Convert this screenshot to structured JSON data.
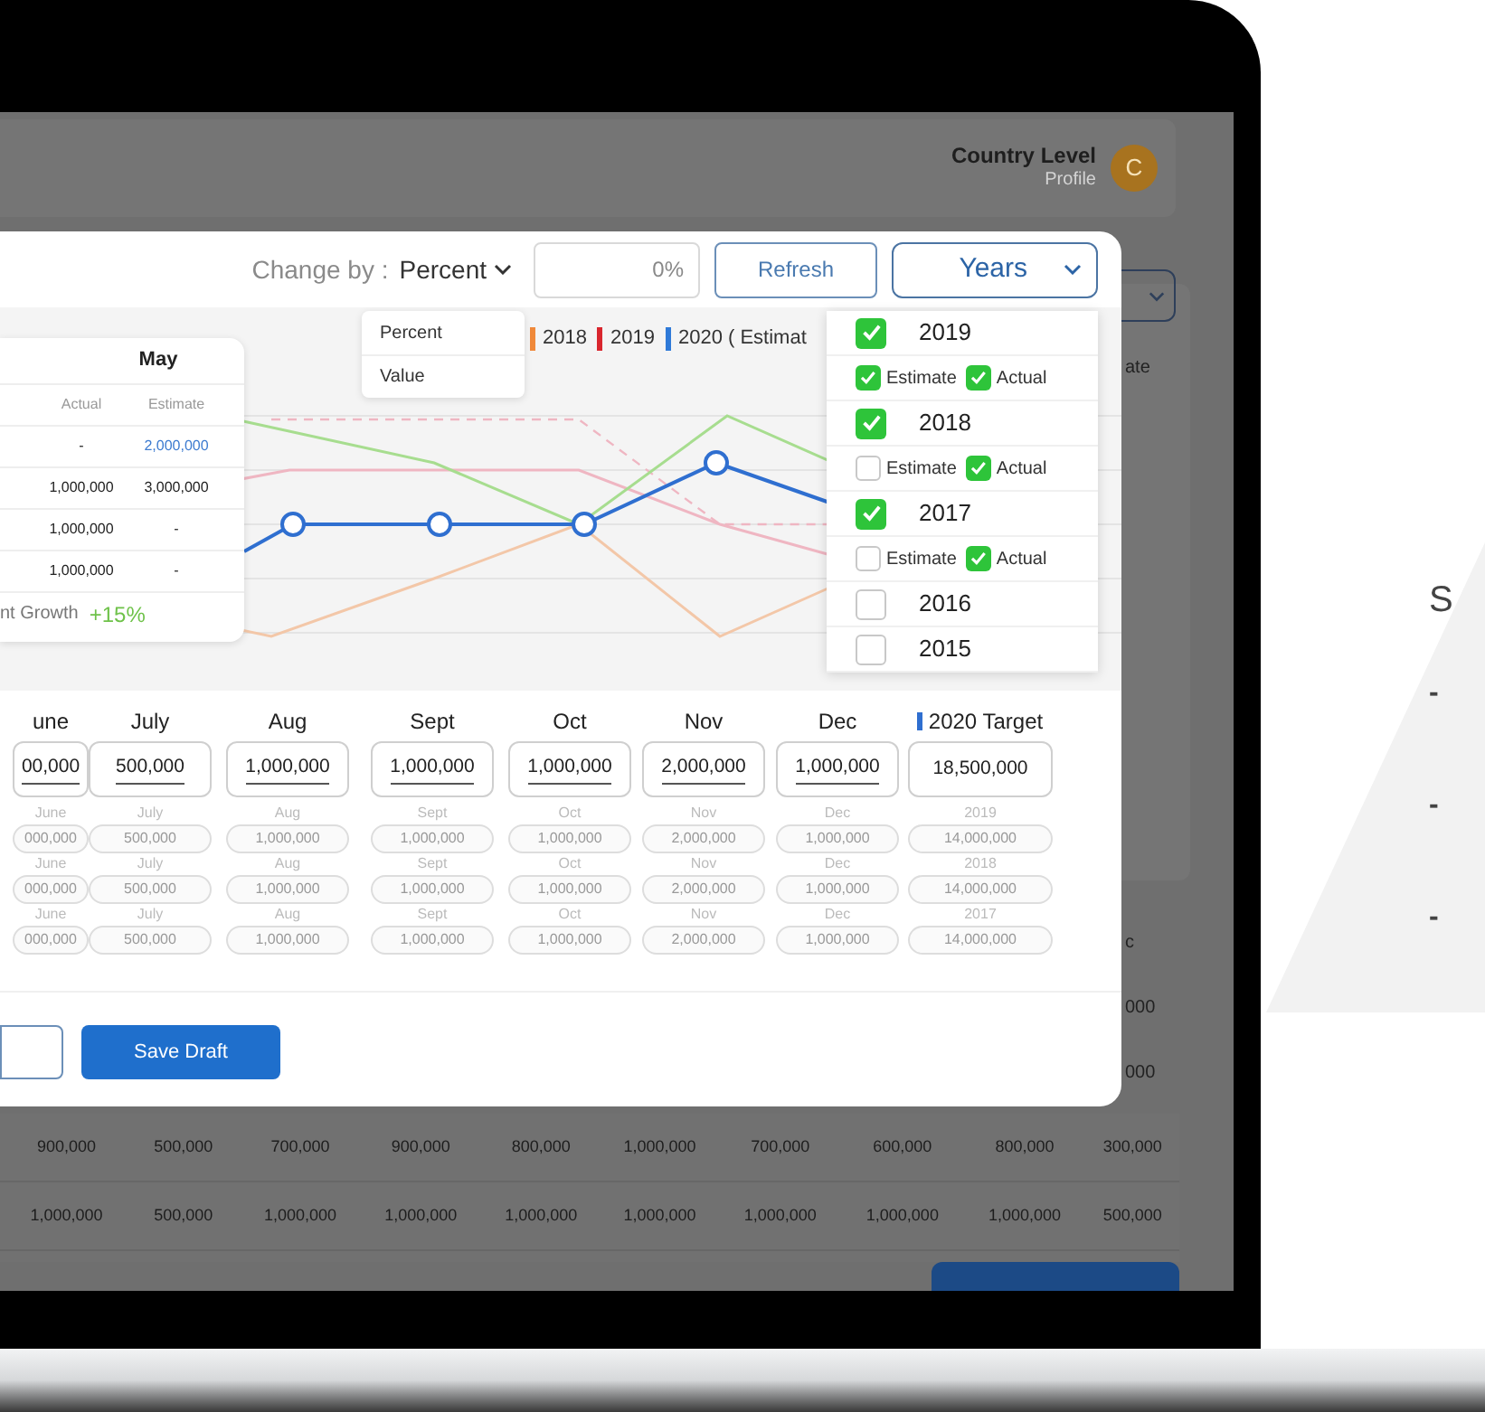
{
  "header": {
    "title": "Country Level",
    "subtitle": "Profile",
    "avatar": "C"
  },
  "toolbar": {
    "change_by_label": "Change by :",
    "mode": "Percent",
    "amount": "0%",
    "refresh": "Refresh",
    "years": "Years"
  },
  "mode_menu": [
    {
      "label": "Percent"
    },
    {
      "label": "Value"
    }
  ],
  "legend": [
    {
      "label": "2018",
      "color": "#f0893a"
    },
    {
      "label": "2019",
      "color": "#d9262e"
    },
    {
      "label": "2020 ( Estimat",
      "color": "#2f7ad8"
    }
  ],
  "tooltip": {
    "title": "May",
    "columns": [
      "Actual",
      "Estimate"
    ],
    "rows": [
      {
        "actual": "-",
        "estimate": "2,000,000",
        "highlighted": true
      },
      {
        "actual": "1,000,000",
        "estimate": "3,000,000",
        "highlighted": false
      },
      {
        "actual": "1,000,000",
        "estimate": "-",
        "highlighted": false
      },
      {
        "actual": "1,000,000",
        "estimate": "-",
        "highlighted": false
      }
    ],
    "growth_label": "nt Growth",
    "growth": "+15%"
  },
  "years_panel": [
    {
      "year": "2019",
      "checked": true,
      "options": [
        {
          "label": "Estimate",
          "checked": true
        },
        {
          "label": "Actual",
          "checked": true
        }
      ]
    },
    {
      "year": "2018",
      "checked": true,
      "options": [
        {
          "label": "Estimate",
          "checked": false
        },
        {
          "label": "Actual",
          "checked": true
        }
      ]
    },
    {
      "year": "2017",
      "checked": true,
      "options": [
        {
          "label": "Estimate",
          "checked": false
        },
        {
          "label": "Actual",
          "checked": true
        }
      ]
    },
    {
      "year": "2016",
      "checked": false
    },
    {
      "year": "2015",
      "checked": false
    }
  ],
  "months": [
    {
      "label": "une",
      "value": "00,000",
      "history": [
        {
          "label": "June",
          "value": "000,000"
        },
        {
          "label": "June",
          "value": "000,000"
        },
        {
          "label": "June",
          "value": "000,000"
        }
      ]
    },
    {
      "label": "July",
      "value": "500,000",
      "history": [
        {
          "label": "July",
          "value": "500,000"
        },
        {
          "label": "July",
          "value": "500,000"
        },
        {
          "label": "July",
          "value": "500,000"
        }
      ]
    },
    {
      "label": "Aug",
      "value": "1,000,000",
      "history": [
        {
          "label": "Aug",
          "value": "1,000,000"
        },
        {
          "label": "Aug",
          "value": "1,000,000"
        },
        {
          "label": "Aug",
          "value": "1,000,000"
        }
      ]
    },
    {
      "label": "Sept",
      "value": "1,000,000",
      "history": [
        {
          "label": "Sept",
          "value": "1,000,000"
        },
        {
          "label": "Sept",
          "value": "1,000,000"
        },
        {
          "label": "Sept",
          "value": "1,000,000"
        }
      ]
    },
    {
      "label": "Oct",
      "value": "1,000,000",
      "history": [
        {
          "label": "Oct",
          "value": "1,000,000"
        },
        {
          "label": "Oct",
          "value": "1,000,000"
        },
        {
          "label": "Oct",
          "value": "1,000,000"
        }
      ]
    },
    {
      "label": "Nov",
      "value": "2,000,000",
      "history": [
        {
          "label": "Nov",
          "value": "2,000,000"
        },
        {
          "label": "Nov",
          "value": "2,000,000"
        },
        {
          "label": "Nov",
          "value": "2,000,000"
        }
      ]
    },
    {
      "label": "Dec",
      "value": "1,000,000",
      "history": [
        {
          "label": "Dec",
          "value": "1,000,000"
        },
        {
          "label": "Dec",
          "value": "1,000,000"
        },
        {
          "label": "Dec",
          "value": "1,000,000"
        }
      ]
    },
    {
      "label": "2020 Target",
      "value": "18,500,000",
      "kind": "target",
      "history": [
        {
          "label": "2019",
          "value": "14,000,000"
        },
        {
          "label": "2018",
          "value": "14,000,000"
        },
        {
          "label": "2017",
          "value": "14,000,000"
        }
      ]
    }
  ],
  "actions": [
    {
      "kind": "outline"
    },
    {
      "kind": "primary",
      "label": "Save Draft"
    }
  ],
  "background": {
    "fragments": [
      "ate",
      "c",
      "000",
      "000"
    ],
    "rows": [
      [
        "900,000",
        "500,000",
        "700,000",
        "900,000",
        "800,000",
        "1,000,000",
        "700,000",
        "600,000",
        "800,000",
        "300,000"
      ],
      [
        "1,000,000",
        "500,000",
        "1,000,000",
        "1,000,000",
        "1,000,000",
        "1,000,000",
        "1,000,000",
        "1,000,000",
        "1,000,000",
        "500,000"
      ]
    ]
  },
  "side": {
    "heading": "S",
    "bullets": [
      "-",
      "-",
      "-"
    ]
  }
}
